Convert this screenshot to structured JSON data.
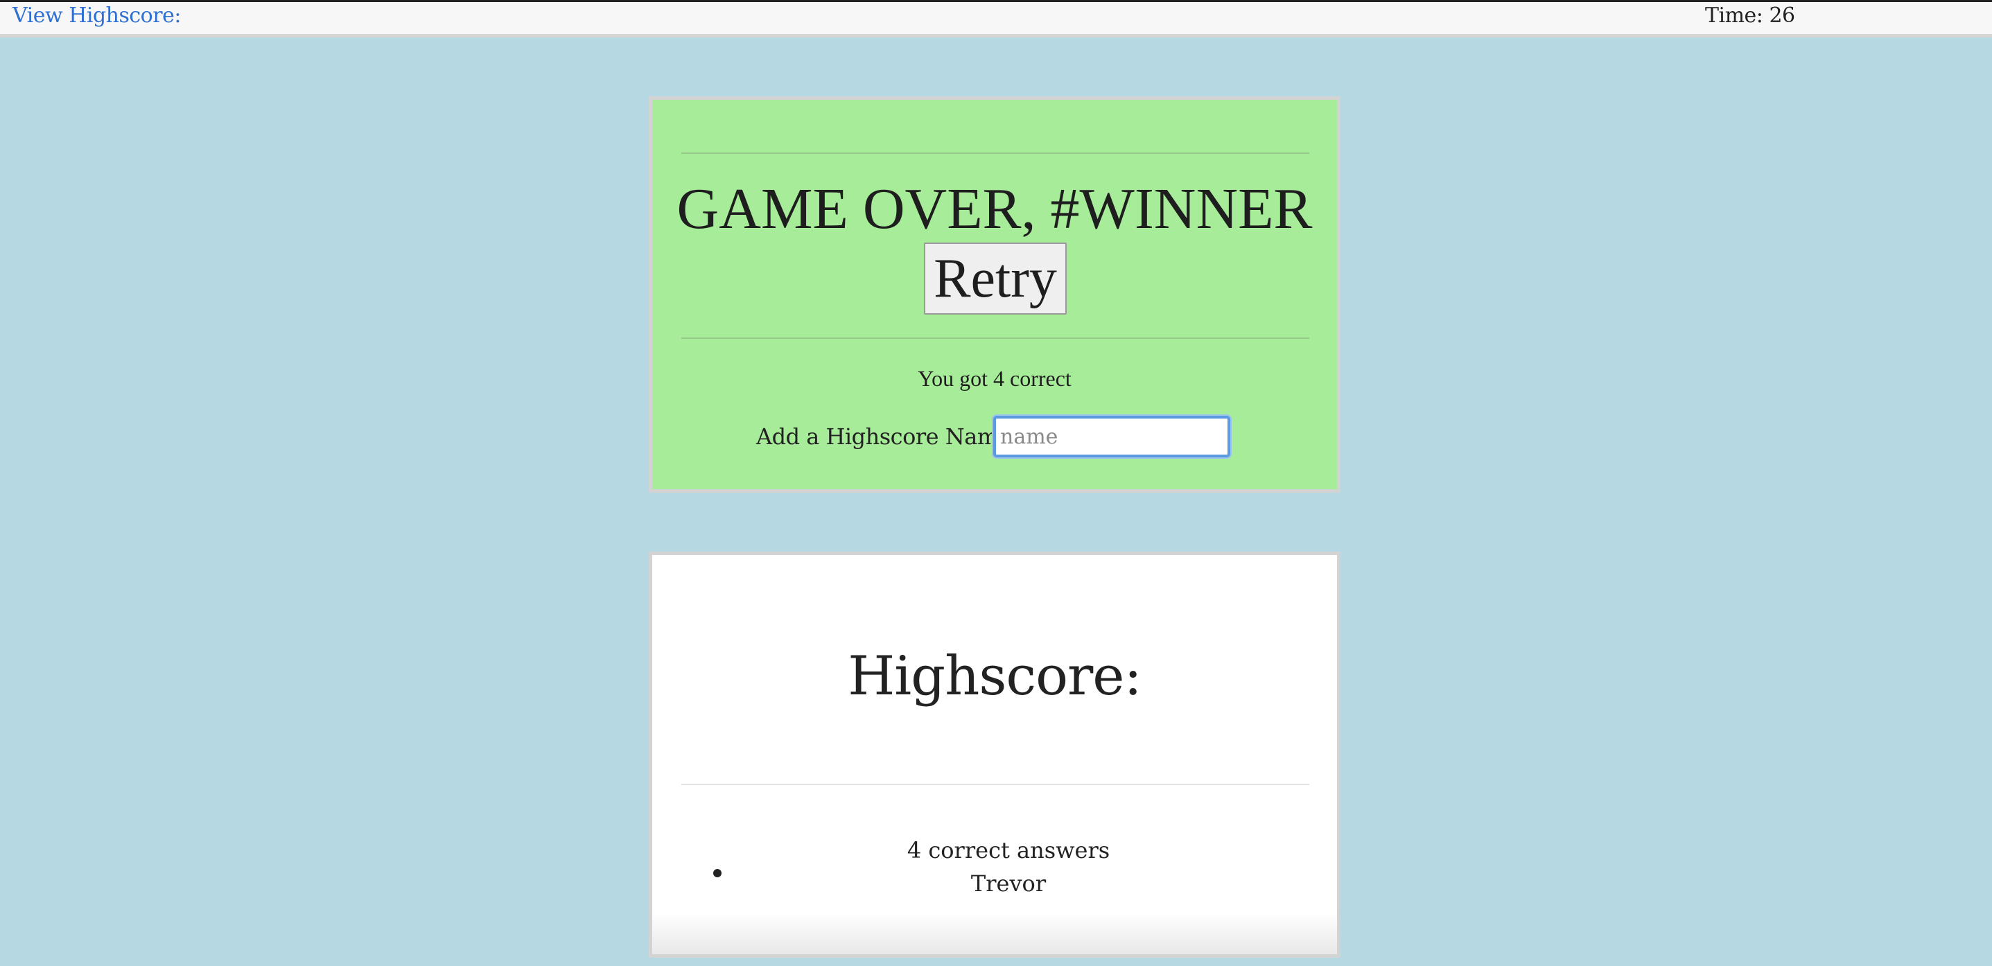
{
  "topbar": {
    "view_highscore_label": "View Highscore:",
    "timer_label": "Time: 26"
  },
  "game_over_card": {
    "title": "GAME OVER, #WINNER",
    "retry_label": "Retry",
    "score_text": "You got 4 correct",
    "name_label": "Add a Highscore Name:",
    "name_placeholder": "name",
    "name_value": ""
  },
  "highscore_card": {
    "title": "Highscore:",
    "entries": [
      {
        "score": "4 correct answers",
        "name": "Trevor"
      }
    ]
  },
  "colors": {
    "page_background": "#b5d8e2",
    "game_over_card_background": "#a7ec98",
    "highscore_card_background": "#ffffff",
    "link_color": "#2f6fd1",
    "input_focus_ring": "#5b9ae0"
  }
}
